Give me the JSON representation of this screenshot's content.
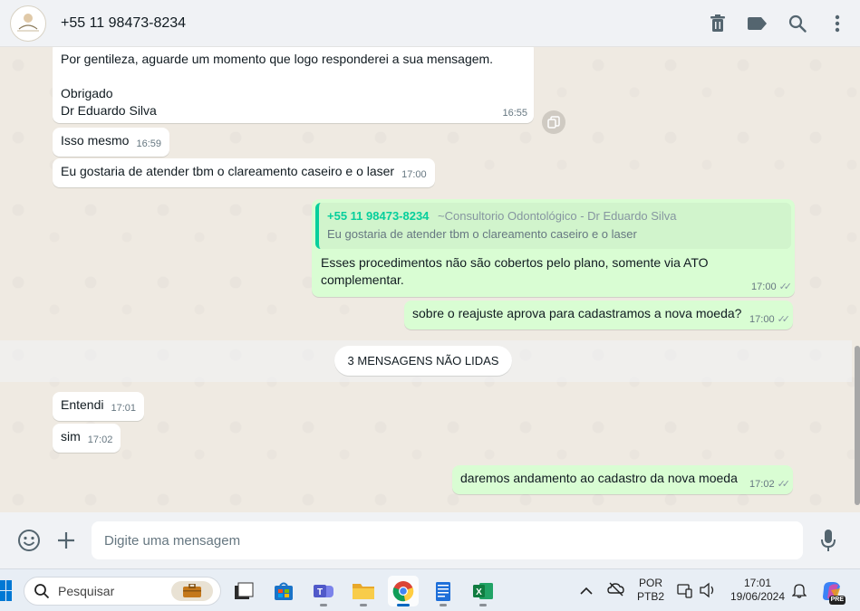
{
  "header": {
    "title": "+55 11 98473-8234",
    "actions": [
      "delete-icon",
      "label-icon",
      "search-icon",
      "menu-icon"
    ]
  },
  "messages": [
    {
      "dir": "in",
      "lines": [
        "Por gentileza, aguarde um momento que logo responderei a sua mensagem.",
        "",
        "Obrigado",
        "Dr Eduardo Silva"
      ],
      "time": "16:55"
    },
    {
      "dir": "in",
      "text": "Isso mesmo",
      "time": "16:59"
    },
    {
      "dir": "in",
      "text": "Eu gostaria de atender tbm o clareamento caseiro e o laser",
      "time": "17:00"
    },
    {
      "dir": "out",
      "quote_author": "+55 11 98473-8234",
      "quote_group": "~Consultorio Odontológico - Dr Eduardo Silva",
      "quote_text": "Eu gostaria de atender tbm o clareamento caseiro e o laser",
      "text": "Esses procedimentos não são cobertos pelo plano, somente via ATO complementar.",
      "time": "17:00"
    },
    {
      "dir": "out",
      "text": "sobre o reajuste aprova para cadastramos a nova moeda?",
      "time": "17:00"
    },
    {
      "dir": "in",
      "text": "Entendi",
      "time": "17:01"
    },
    {
      "dir": "in",
      "text": "sim",
      "time": "17:02"
    },
    {
      "dir": "out",
      "text": "daremos andamento ao cadastro da nova moeda",
      "time": "17:02"
    }
  ],
  "unread_label": "3 MENSAGENS NÃO LIDAS",
  "composer": {
    "placeholder": "Digite uma mensagem"
  },
  "taskbar": {
    "search_placeholder": "Pesquisar",
    "apps": [
      "file-explorer-icon",
      "microsoft-store-icon",
      "teams-icon",
      "folder-icon",
      "chrome-icon",
      "notepad-icon",
      "excel-icon"
    ],
    "lang_top": "POR",
    "lang_bottom": "PTB2",
    "clock_time": "17:01",
    "clock_date": "19/06/2024",
    "copilot_badge": "PRE"
  },
  "colors": {
    "outgoing_bubble": "#d9fdd3",
    "incoming_bubble": "#ffffff",
    "accent": "#06cf9c",
    "chat_bg": "#efeae2"
  }
}
